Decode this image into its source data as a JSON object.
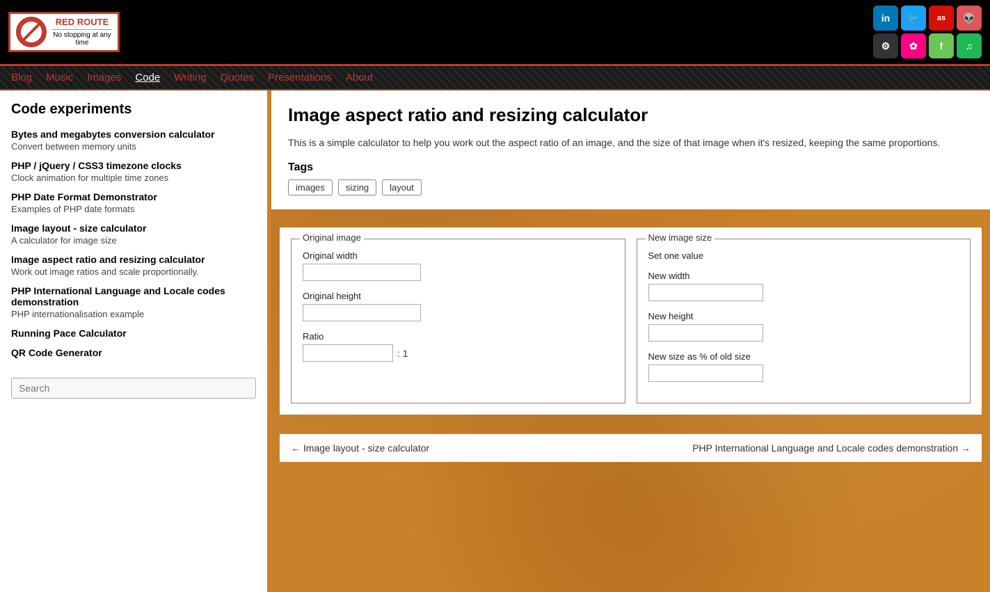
{
  "header": {
    "logo": {
      "title": "RED ROUTE",
      "subtitle": "No stopping at any time"
    },
    "social": [
      {
        "name": "linkedin",
        "label": "in",
        "class": "social-linkedin"
      },
      {
        "name": "twitter",
        "label": "🐦",
        "class": "social-twitter"
      },
      {
        "name": "lastfm",
        "label": "as",
        "class": "social-lastfm"
      },
      {
        "name": "alien",
        "label": "👽",
        "class": "social-lastfm2"
      },
      {
        "name": "github",
        "label": "⚙",
        "class": "social-github"
      },
      {
        "name": "flickr",
        "label": "✿",
        "class": "social-flickr"
      },
      {
        "name": "feedly",
        "label": "f",
        "class": "social-feedly"
      },
      {
        "name": "spotify",
        "label": "♫",
        "class": "social-spotify"
      }
    ]
  },
  "nav": {
    "items": [
      {
        "label": "Blog",
        "active": false
      },
      {
        "label": "Music",
        "active": false
      },
      {
        "label": "Images",
        "active": false
      },
      {
        "label": "Code",
        "active": true
      },
      {
        "label": "Writing",
        "active": false
      },
      {
        "label": "Quotes",
        "active": false
      },
      {
        "label": "Presentations",
        "active": false
      },
      {
        "label": "About",
        "active": false
      }
    ]
  },
  "sidebar": {
    "title": "Code experiments",
    "items": [
      {
        "link": "Bytes and megabytes conversion calculator",
        "desc": "Convert between memory units"
      },
      {
        "link": "PHP / jQuery / CSS3 timezone clocks",
        "desc": "Clock animation for multiple time zones"
      },
      {
        "link": "PHP Date Format Demonstrator",
        "desc": "Examples of PHP date formats"
      },
      {
        "link": "Image layout - size calculator",
        "desc": "A calculator for image size"
      },
      {
        "link": "Image aspect ratio and resizing calculator",
        "desc": "Work out image ratios and scale proportionally."
      },
      {
        "link": "PHP International Language and Locale codes demonstration",
        "desc": "PHP internationalisation example"
      },
      {
        "link": "Running Pace Calculator",
        "desc": ""
      },
      {
        "link": "QR Code Generator",
        "desc": ""
      }
    ],
    "search_placeholder": "Search"
  },
  "main": {
    "title": "Image aspect ratio and resizing calculator",
    "description": "This is a simple calculator to help you work out the aspect ratio of an image, and the size of that image when it's resized, keeping the same proportions.",
    "tags_label": "Tags",
    "tags": [
      "images",
      "sizing",
      "layout"
    ],
    "original_image": {
      "legend": "Original image",
      "width_label": "Original width",
      "height_label": "Original height",
      "ratio_label": "Ratio",
      "ratio_suffix": ": 1"
    },
    "new_image": {
      "legend": "New image size",
      "set_value_label": "Set one value",
      "width_label": "New width",
      "height_label": "New height",
      "percent_label": "New size as % of old size"
    }
  },
  "bottom_nav": {
    "prev_label": "← Image layout - size calculator",
    "next_label": "PHP International Language and Locale codes demonstration →"
  }
}
